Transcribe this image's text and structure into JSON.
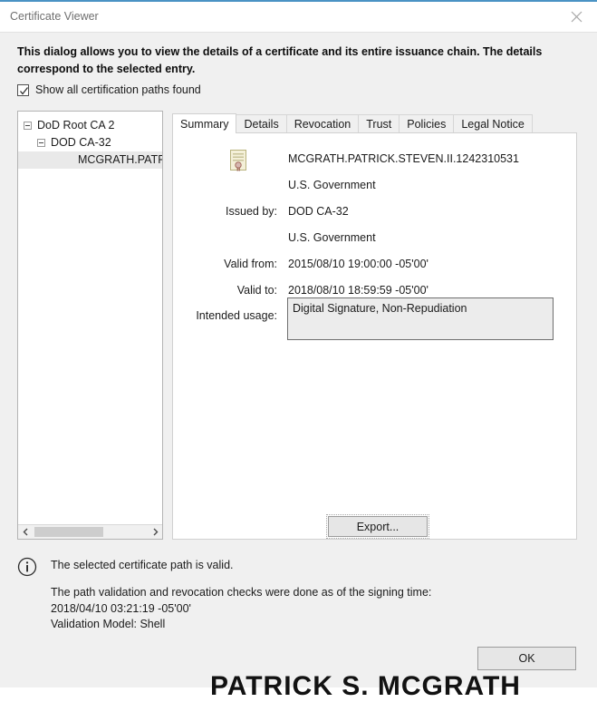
{
  "window": {
    "title": "Certificate Viewer",
    "close_icon": "close-icon"
  },
  "instruction": "This dialog allows you to view the details of a certificate and its entire issuance chain. The details correspond to the selected entry.",
  "checkbox": {
    "label": "Show all certification paths found",
    "checked": true
  },
  "tree": {
    "items": [
      {
        "label": "DoD Root CA 2",
        "depth": 0,
        "expanded": true,
        "selected": false
      },
      {
        "label": "DOD CA-32",
        "depth": 1,
        "expanded": true,
        "selected": false
      },
      {
        "label": "MCGRATH.PATRI",
        "depth": 2,
        "expanded": false,
        "selected": true
      }
    ],
    "scrollbar": {
      "left_arrow": "‹",
      "right_arrow": "›"
    }
  },
  "tabs": [
    {
      "label": "Summary",
      "active": true
    },
    {
      "label": "Details",
      "active": false
    },
    {
      "label": "Revocation",
      "active": false
    },
    {
      "label": "Trust",
      "active": false
    },
    {
      "label": "Policies",
      "active": false
    },
    {
      "label": "Legal Notice",
      "active": false
    }
  ],
  "summary": {
    "icon": "certificate-icon",
    "subject_common_name": "MCGRATH.PATRICK.STEVEN.II.1242310531",
    "subject_organization": "U.S. Government",
    "issued_by_label": "Issued by:",
    "issued_by_value": "DOD CA-32",
    "issuer_organization": "U.S. Government",
    "valid_from_label": "Valid from:",
    "valid_from_value": "2015/08/10 19:00:00 -05'00'",
    "valid_to_label": "Valid to:",
    "valid_to_value": "2018/08/10 18:59:59 -05'00'",
    "intended_usage_label": "Intended usage:",
    "intended_usage_value": "Digital Signature, Non-Repudiation",
    "export_button": "Export..."
  },
  "status": {
    "icon": "info-icon",
    "message": "The selected certificate path is valid.",
    "details": "The path validation and revocation checks were done as of the signing time:\n2018/04/10 03:21:19 -05'00'\nValidation Model: Shell"
  },
  "footer": {
    "ok_button": "OK"
  },
  "background": {
    "signature_text": "PATRICK S. MCGRATH"
  },
  "colors": {
    "accent": "#4a93c4",
    "dialog_bg": "#f0f0f0",
    "panel_bg": "#ffffff",
    "selection": "#e9e9e9",
    "button_bg": "#e6e6e6",
    "readonly_bg": "#ececec"
  }
}
